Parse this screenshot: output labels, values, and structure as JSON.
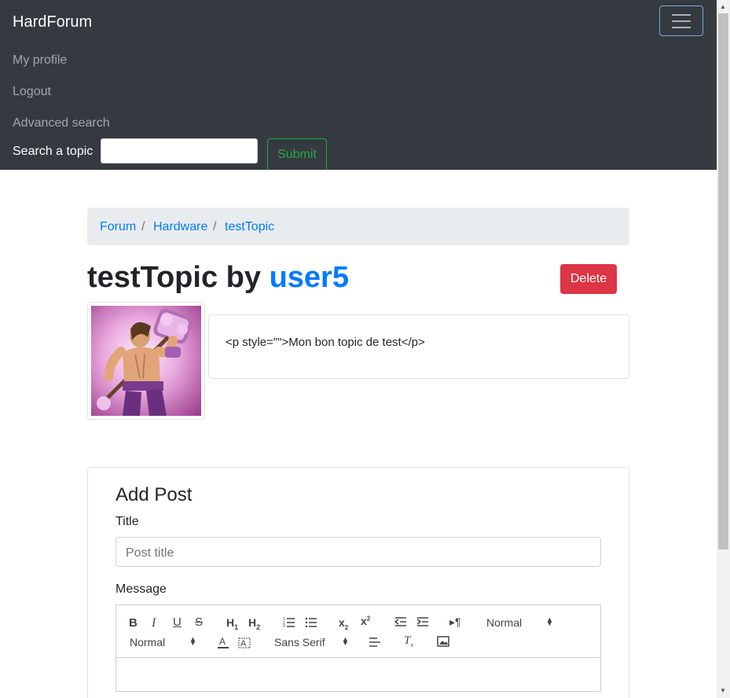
{
  "navbar": {
    "brand": "HardForum",
    "links": [
      "My profile",
      "Logout",
      "Advanced search"
    ],
    "search_label": "Search a topic",
    "search_value": "",
    "submit_label": "Submit"
  },
  "breadcrumb": [
    "Forum",
    "Hardware",
    "testTopic"
  ],
  "topic": {
    "title": "testTopic",
    "by": "by",
    "author": "user5",
    "delete_label": "Delete",
    "content": "<p style=\"\">Mon bon topic de test</p>"
  },
  "add_post": {
    "heading": "Add Post",
    "title_label": "Title",
    "title_placeholder": "Post title",
    "message_label": "Message",
    "toolbar": {
      "header_select": "Normal",
      "size_select": "Normal",
      "font_select": "Sans Serif"
    }
  },
  "colors": {
    "navbar_bg": "#343a40",
    "link": "#007bff",
    "danger": "#dc3545",
    "success": "#28a745"
  }
}
